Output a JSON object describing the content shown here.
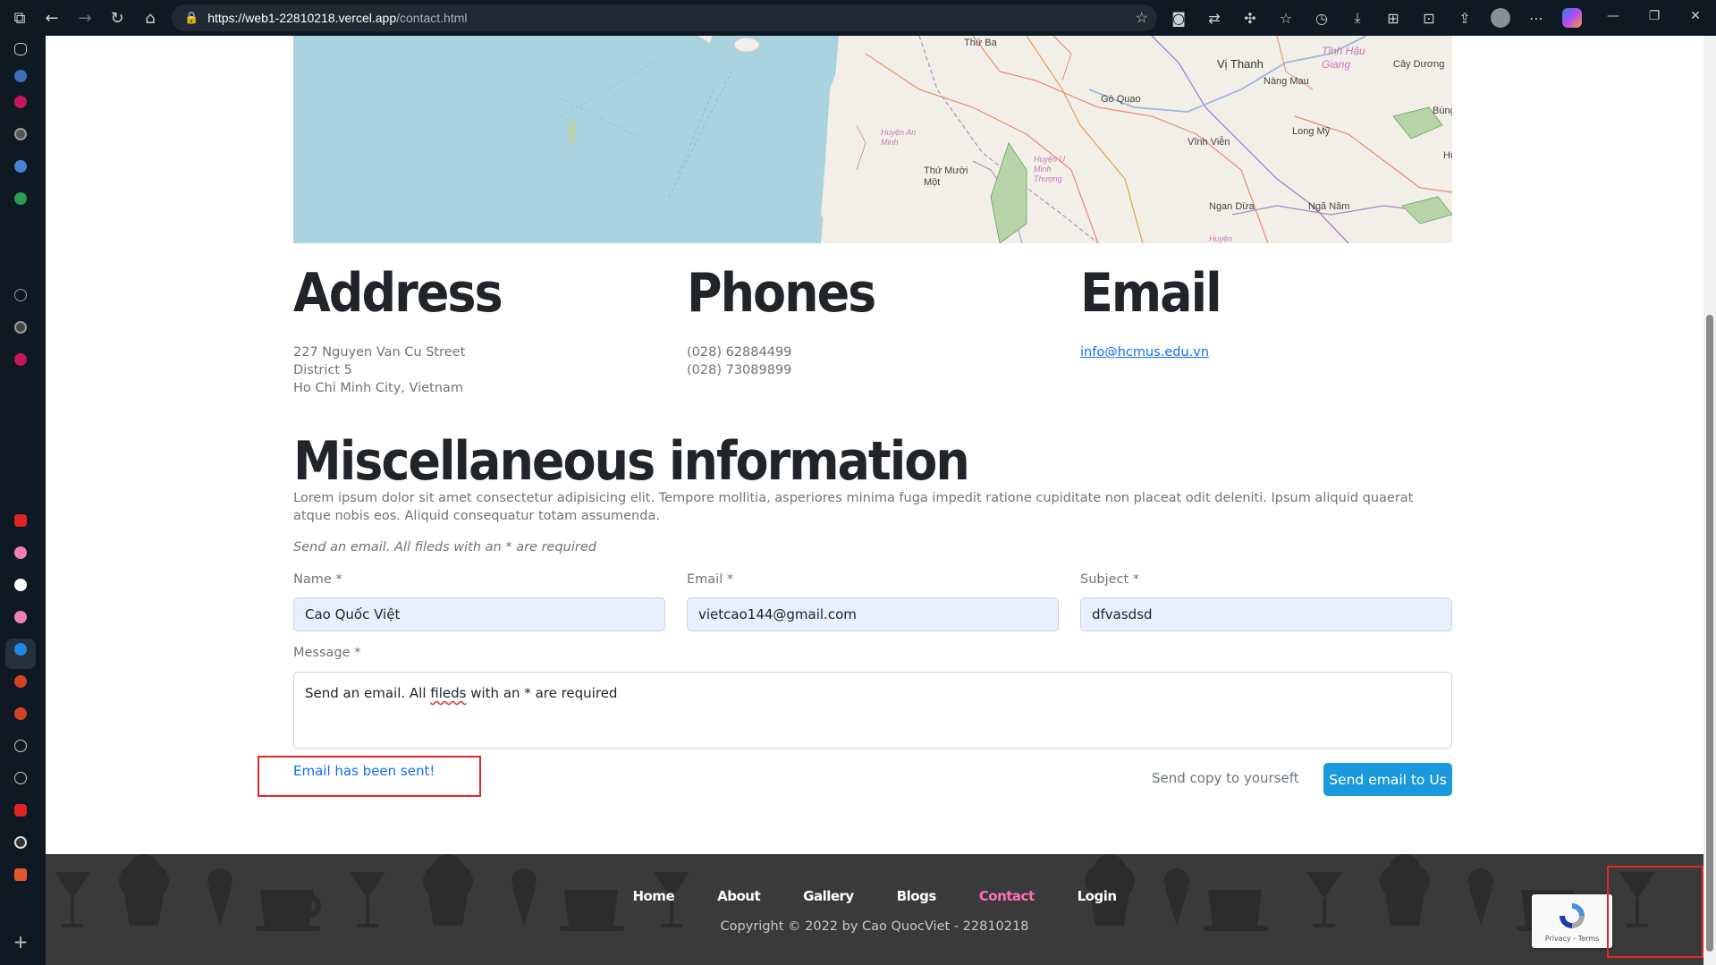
{
  "browser": {
    "url_host": "https://web1-22810218.vercel.app",
    "url_path": "/contact.html"
  },
  "map": {
    "labels": [
      "Thứ Ba",
      "Vị Thanh",
      "Tĩnh Hậu Giang",
      "Cây Dương",
      "Nàng Mau",
      "Gò Quao",
      "Long Mỹ",
      "Bùng",
      "Vĩnh Viễn",
      "Huyện An Minh",
      "Huyện U Minh Thượng",
      "Thứ Mười Một",
      "Ngan Dừa",
      "Ngã Năm",
      "Huyện",
      "Hư"
    ]
  },
  "contact": {
    "address_heading": "Address",
    "address_lines": [
      "227 Nguyen Van Cu Street",
      "District 5",
      "Ho Chi Minh City, Vietnam"
    ],
    "phones_heading": "Phones",
    "phone_lines": [
      "(028) 62884499",
      "(028) 73089899"
    ],
    "email_heading": "Email",
    "email_link": "info@hcmus.edu.vn"
  },
  "misc": {
    "heading": "Miscellaneous information",
    "paragraph": "Lorem ipsum dolor sit amet consectetur adipisicing elit. Tempore mollitia, asperiores minima fuga impedit ratione cupiditate non placeat odit deleniti. Ipsum aliquid quaerat atque nobis eos. Aliquid consequatur totam assumenda."
  },
  "form": {
    "note": "Send an email. All fileds with an * are required",
    "name_label": "Name *",
    "name_value": "Cao Quốc Việt",
    "email_label": "Email *",
    "email_value": "vietcao144@gmail.com",
    "subject_label": "Subject *",
    "subject_value": "dfvasdsd",
    "message_label": "Message *",
    "message_pre": "Send an email. All ",
    "message_misspelled": "fileds",
    "message_post": " with an * are required",
    "sent_message": "Email has been sent!",
    "copy_label": "Send copy to yourseft",
    "copy_checked": true,
    "send_button": "Send email to Us"
  },
  "footer": {
    "nav": [
      "Home",
      "About",
      "Gallery",
      "Blogs",
      "Contact",
      "Login"
    ],
    "active": "Contact",
    "copyright": "Copyright © 2022 by Cao QuocViet - 22810218"
  },
  "recaptcha": {
    "text": "Privacy - Terms"
  },
  "colors": {
    "accent": "#1c98dc",
    "link": "#0d6efd",
    "active_nav": "#ff6fb5",
    "highlight_box": "#e3262c"
  }
}
